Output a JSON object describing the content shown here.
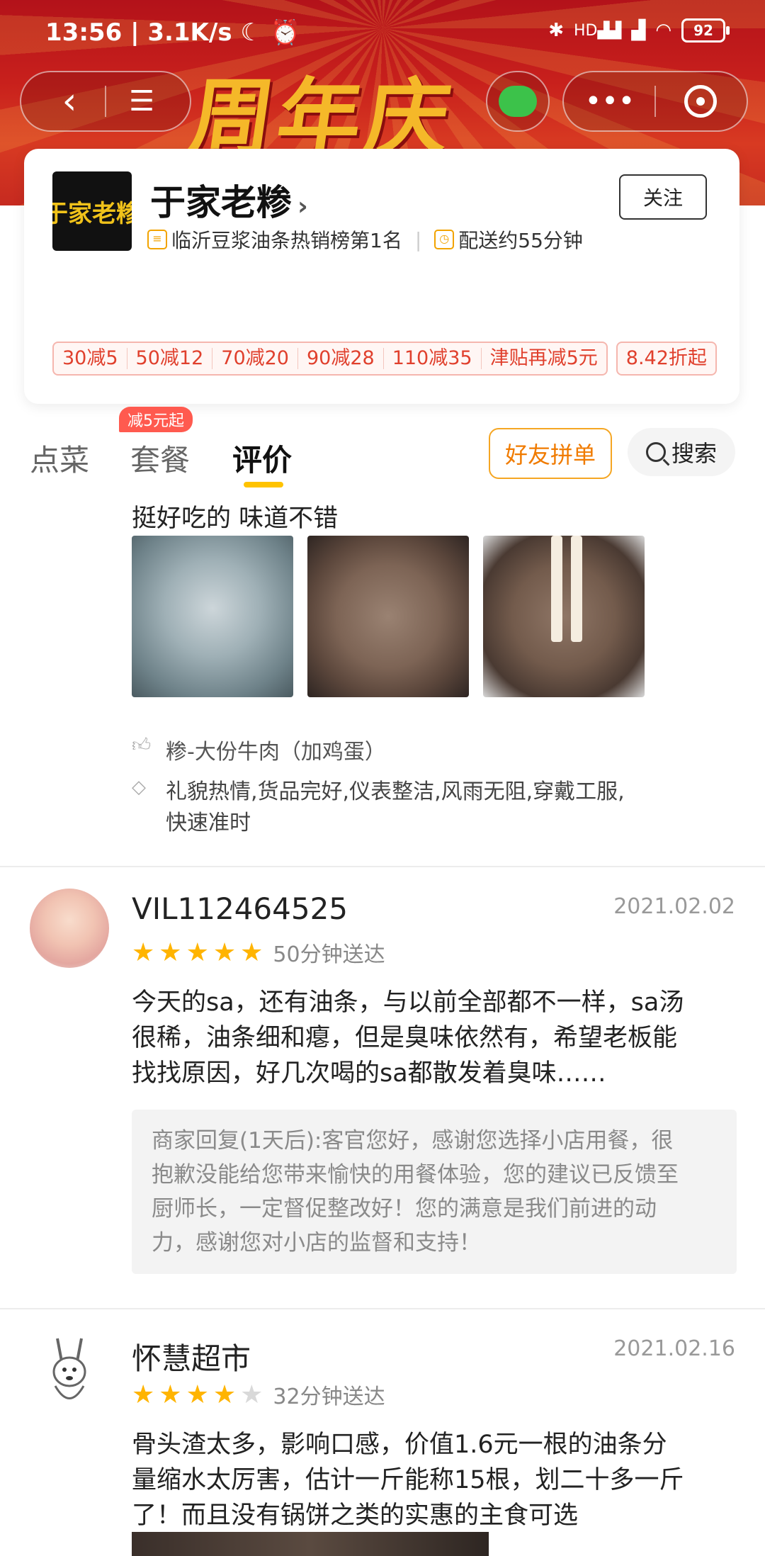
{
  "status_bar": {
    "time": "13:56",
    "speed": "3.1K/s",
    "battery": "92",
    "network": "HD"
  },
  "banner": {
    "text": "周年庆"
  },
  "shop": {
    "name": "于家老糁",
    "logo_text": "于家老糁",
    "follow_label": "关注",
    "rank": "临沂豆浆油条热销榜第1名",
    "delivery": "配送约55分钟",
    "coupons": [
      "30减5",
      "50减12",
      "70减20",
      "90减28",
      "110减35",
      "津贴再减5元"
    ],
    "discount": "8.42折起"
  },
  "tabs": {
    "items": [
      "点菜",
      "套餐",
      "评价"
    ],
    "active": "评价",
    "badge": "减5元起",
    "group_order": "好友拼单",
    "search": "搜索"
  },
  "review0": {
    "text": "挺好吃的 味道不错",
    "liked_item": "糁-大份牛肉（加鸡蛋）",
    "tags": "礼貌热情,货品完好,仪表整洁,风雨无阻,穿戴工服,",
    "tags2": "快速准时"
  },
  "review1": {
    "user": "VIL112464525",
    "date": "2021.02.02",
    "stars": 5,
    "eta": "50分钟送达",
    "text_lines": [
      "今天的sa，还有油条，与以前全部都不一样，sa汤",
      "很稀，油条细和瘪，但是臭味依然有，希望老板能",
      "找找原因，好几次喝的sa都散发着臭味……"
    ],
    "reply_lines": [
      "商家回复(1天后):客官您好，感谢您选择小店用餐，很",
      "抱歉没能给您带来愉快的用餐体验，您的建议已反馈至",
      "厨师长，一定督促整改好！您的满意是我们前进的动",
      "力，感谢您对小店的监督和支持！"
    ]
  },
  "review2": {
    "user": "怀慧超市",
    "date": "2021.02.16",
    "stars": 4,
    "eta": "32分钟送达",
    "text_lines": [
      "骨头渣太多，影响口感，价值1.6元一根的油条分",
      "量缩水太厉害，估计一斤能称15根，划二十多一斤",
      "了！而且没有锅饼之类的实惠的主食可选"
    ]
  },
  "colors": {
    "accent": "#ffc300",
    "coupon": "#e0402d",
    "star": "#ffb400",
    "orange": "#f07b00"
  }
}
